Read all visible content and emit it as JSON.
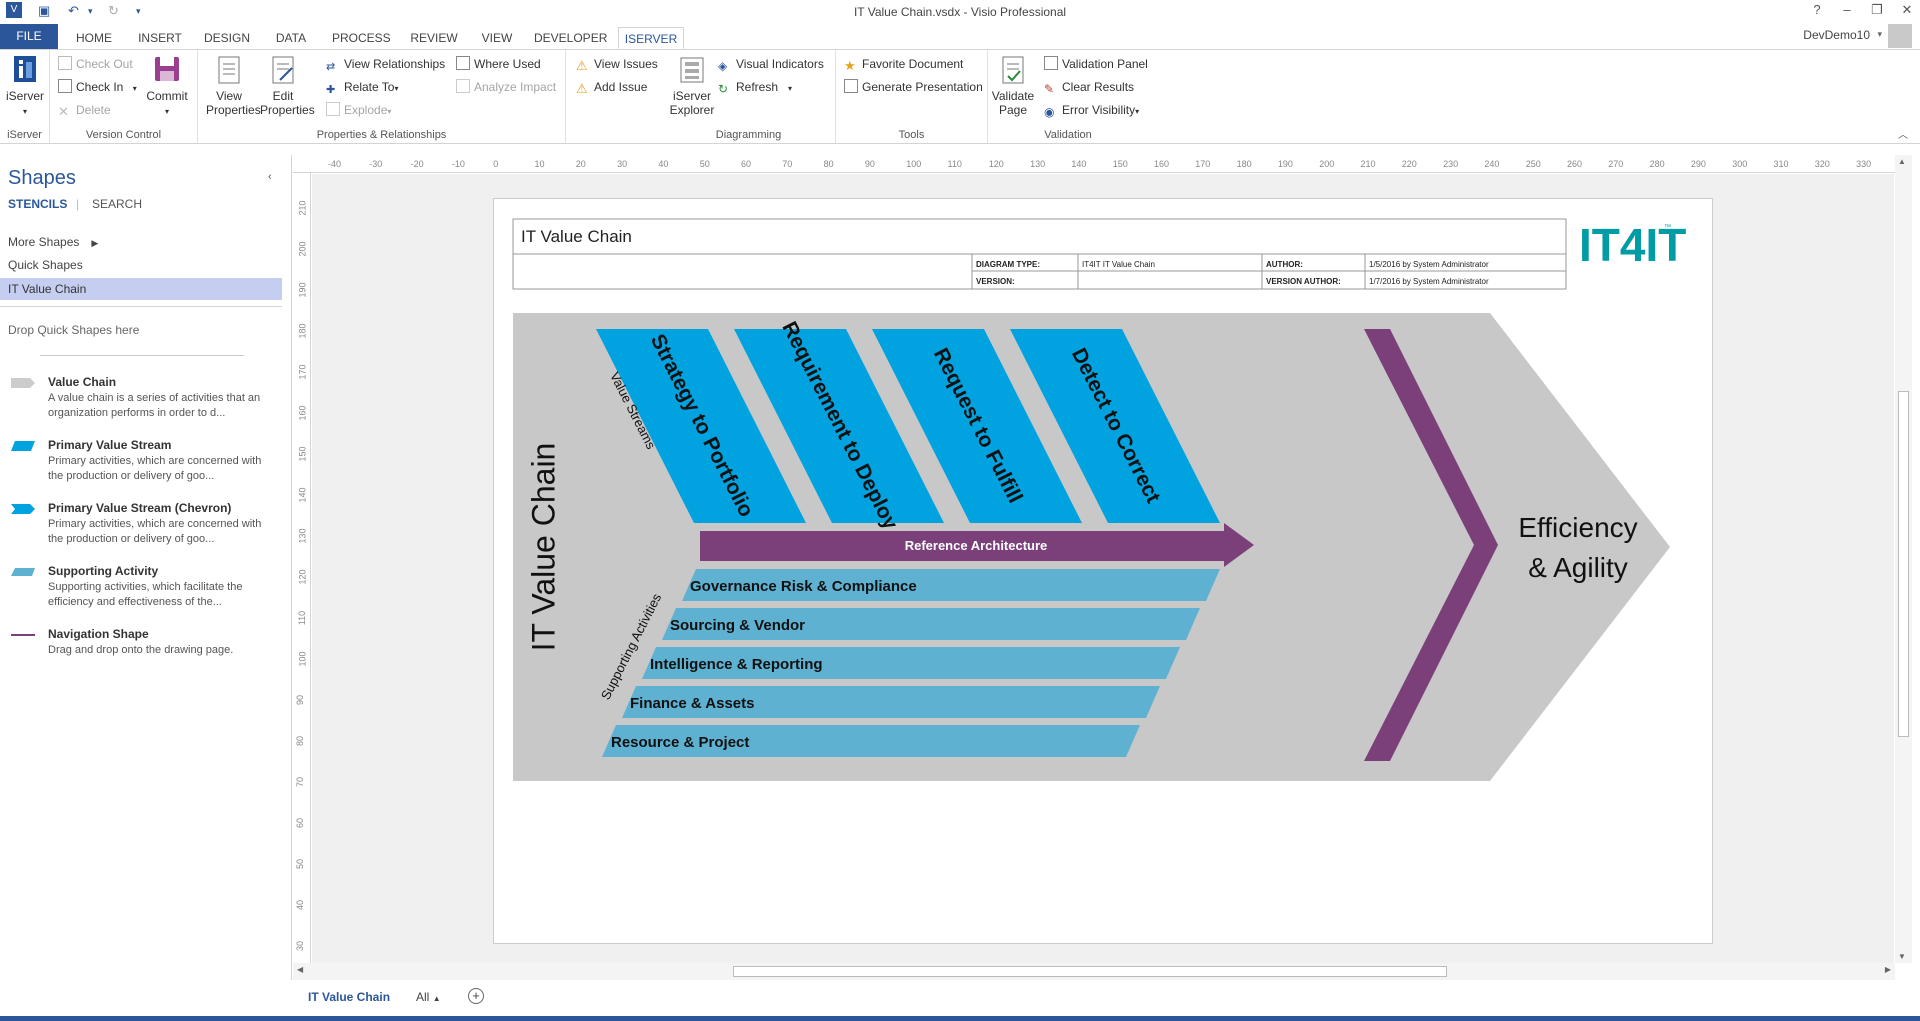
{
  "title": "IT Value Chain.vsdx - Visio Professional",
  "user": "DevDemo10",
  "tabs": [
    "FILE",
    "HOME",
    "INSERT",
    "DESIGN",
    "DATA",
    "PROCESS",
    "REVIEW",
    "VIEW",
    "DEVELOPER",
    "ISERVER"
  ],
  "ribbon": {
    "iserver_label": "iServer",
    "grp_iserver": "iServer",
    "check_out": "Check Out",
    "check_in": "Check In",
    "delete": "Delete",
    "commit": "Commit",
    "grp_version": "Version Control",
    "view_properties": "View Properties",
    "edit_properties": "Edit Properties",
    "view_relationships": "View Relationships",
    "relate_to": "Relate To",
    "explode": "Explode",
    "where_used": "Where Used",
    "analyze_impact": "Analyze Impact",
    "grp_props": "Properties & Relationships",
    "view_issues": "View Issues",
    "add_issue": "Add Issue",
    "iserver_explorer": "iServer Explorer",
    "visual_indicators": "Visual Indicators",
    "refresh": "Refresh",
    "grp_diagramming": "Diagramming",
    "favorite_document": "Favorite Document",
    "generate_presentation": "Generate Presentation",
    "grp_tools": "Tools",
    "validate_page": "Validate Page",
    "validation_panel": "Validation Panel",
    "clear_results": "Clear Results",
    "error_visibility": "Error Visibility",
    "grp_validation": "Validation"
  },
  "shapes_pane": {
    "title": "Shapes",
    "stencils": "STENCILS",
    "search": "SEARCH",
    "more_shapes": "More Shapes",
    "quick_shapes": "Quick Shapes",
    "it_value_chain": "IT Value Chain",
    "drop_hint": "Drop Quick Shapes here",
    "items": [
      {
        "title": "Value Chain",
        "desc": "A value chain is a series of activities that an organization performs in order to d..."
      },
      {
        "title": "Primary Value Stream",
        "desc": "Primary activities, which are concerned with the production or delivery of goo..."
      },
      {
        "title": "Primary Value Stream (Chevron)",
        "desc": "Primary activities, which are concerned with the production or delivery of goo..."
      },
      {
        "title": "Supporting Activity",
        "desc": "Supporting activities, which facilitate the efficiency and effectiveness of the..."
      },
      {
        "title": "Navigation Shape",
        "desc": "Drag and drop onto the drawing page."
      }
    ]
  },
  "ruler": {
    "h": [
      "-40",
      "-30",
      "-20",
      "-10",
      "0",
      "10",
      "20",
      "30",
      "40",
      "50",
      "60",
      "70",
      "80",
      "90",
      "100",
      "110",
      "120",
      "130",
      "140",
      "150",
      "160",
      "170",
      "180",
      "190",
      "200",
      "210",
      "220",
      "230",
      "240",
      "250",
      "260",
      "270",
      "280",
      "290",
      "300",
      "310",
      "320",
      "330"
    ],
    "v": [
      "210",
      "200",
      "190",
      "180",
      "170",
      "160",
      "150",
      "140",
      "130",
      "120",
      "110",
      "100",
      "90",
      "80",
      "70",
      "60",
      "50",
      "40",
      "30"
    ]
  },
  "diagram": {
    "header_title": "IT Value Chain",
    "diagram_type_label": "DIAGRAM TYPE:",
    "diagram_type_value": "IT4IT IT Value Chain",
    "author_label": "AUTHOR:",
    "author_value": "1/5/2016 by System Administrator",
    "version_label": "VERSION:",
    "version_author_label": "VERSION AUTHOR:",
    "version_author_value": "1/7/2016 by System Administrator",
    "logo": "IT4IT",
    "logo_tm": "™",
    "chain_title": "IT Value Chain",
    "value_streams_label": "Value Streams",
    "supporting_label": "Supporting Activities",
    "streams": [
      "Strategy to Portfolio",
      "Requirement to Deploy",
      "Request to Fulfill",
      "Detect to Correct"
    ],
    "reference_architecture": "Reference Architecture",
    "activities": [
      "Governance Risk & Compliance",
      "Sourcing & Vendor",
      "Intelligence & Reporting",
      "Finance & Assets",
      "Resource & Project"
    ],
    "outcome_line1": "Efficiency",
    "outcome_line2": "& Agility"
  },
  "page_tabs": {
    "current": "IT Value Chain",
    "all": "All"
  },
  "colors": {
    "accent": "#2b579a",
    "stream": "#00a3e0",
    "activity": "#5fb1d1",
    "purple": "#7b3f7a",
    "chevron": "#c8c8c8",
    "logo": "#009ca6"
  }
}
